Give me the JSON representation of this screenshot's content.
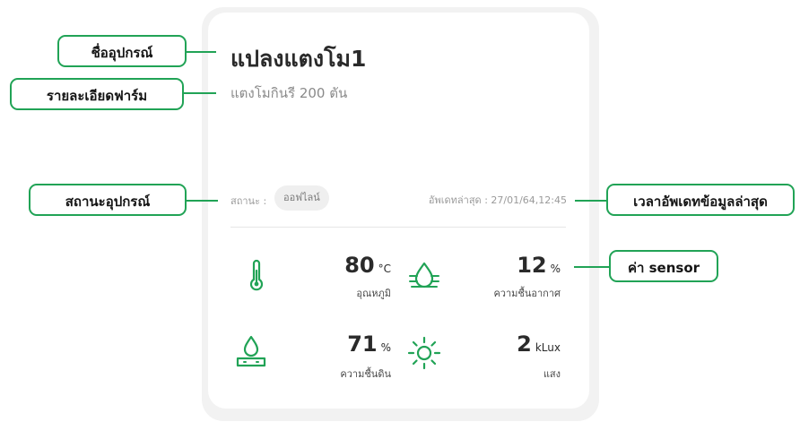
{
  "device": {
    "name": "แปลงแตงโม1",
    "farm_detail": "แตงโมกินรี 200 ตัน"
  },
  "status": {
    "label": "สถานะ :",
    "value": "ออฟไลน์"
  },
  "last_update": {
    "text": "อัพเดทล่าสุด : 27/01/64,12:45"
  },
  "sensors": [
    {
      "icon": "thermometer-icon",
      "value": "80",
      "unit": "°C",
      "label": "อุณหภูมิ"
    },
    {
      "icon": "air-humidity-icon",
      "value": "12",
      "unit": "%",
      "label": "ความชื้นอากาศ"
    },
    {
      "icon": "soil-moisture-icon",
      "value": "71",
      "unit": "%",
      "label": "ความชื้นดิน"
    },
    {
      "icon": "sun-icon",
      "value": "2",
      "unit": "kLux",
      "label": "แสง"
    }
  ],
  "annotations": {
    "device_name": "ชื่ออุปกรณ์",
    "farm_detail": "รายละเอียดฟาร์ม",
    "device_status": "สถานะอุปกรณ์",
    "last_update": "เวลาอัพเดทข้อมูลล่าสุด",
    "sensor_values": "ค่า sensor"
  },
  "colors": {
    "accent": "#21a356",
    "card_shadow": "#f2f2f2",
    "badge_bg": "#efefef"
  }
}
